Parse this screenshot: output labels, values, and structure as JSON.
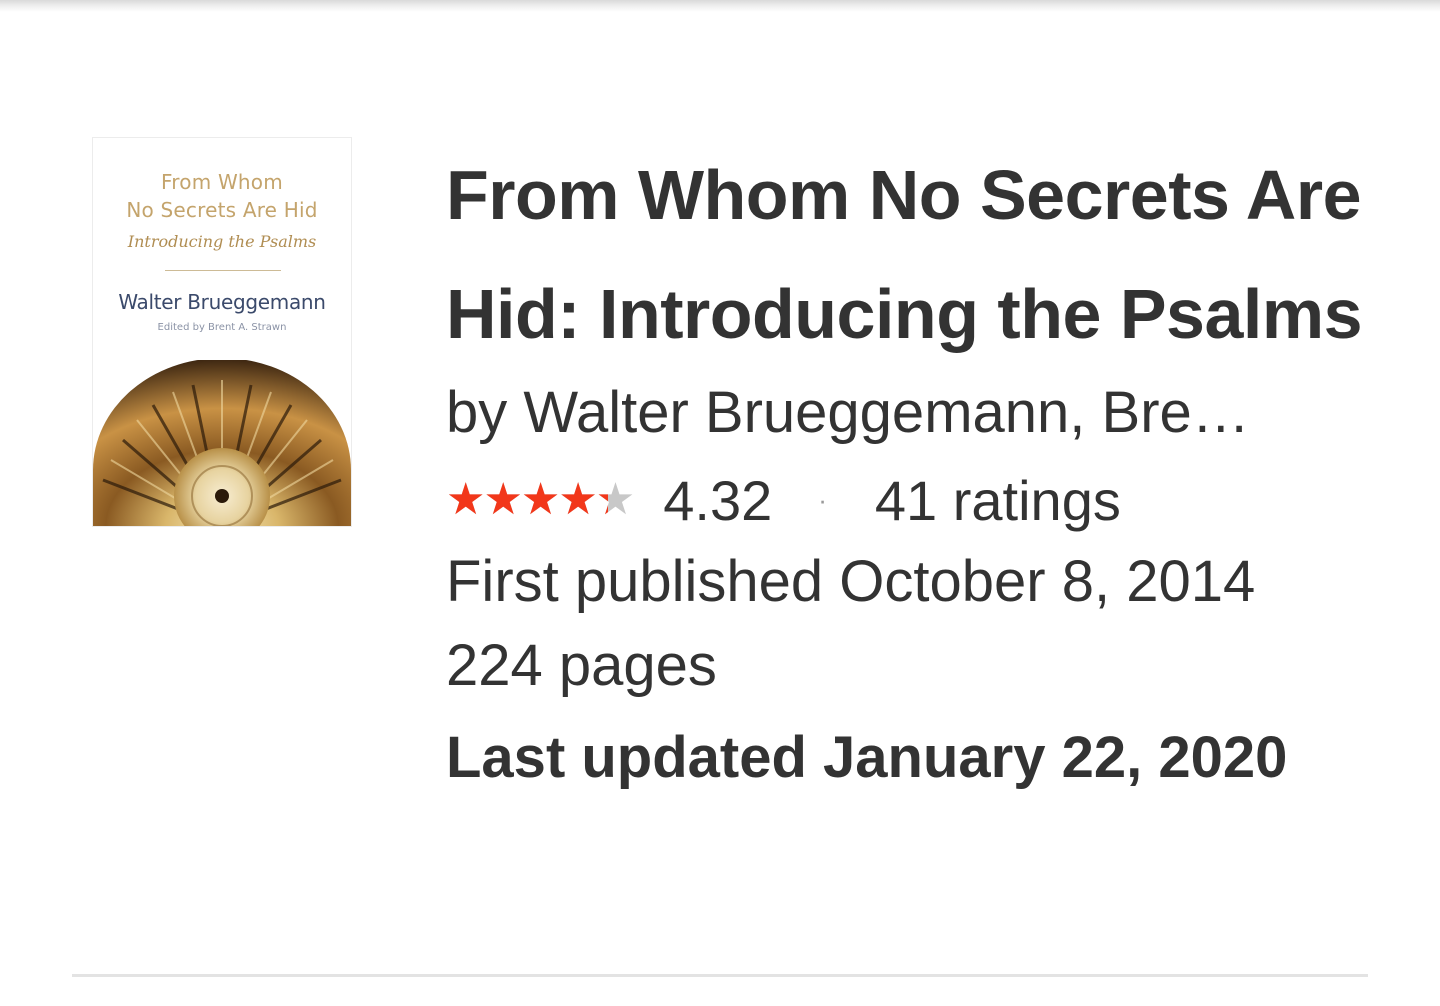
{
  "book": {
    "cover": {
      "title_line1": "From Whom",
      "title_line2": "No Secrets Are Hid",
      "subtitle": "Introducing the Psalms",
      "author": "Walter Brueggemann",
      "editor": "Edited by Brent A. Strawn",
      "accent_color": "#c4a46c"
    },
    "title": "From Whom No Secrets Are Hid: Introducing the Psalms",
    "author_line": "by Walter Brueggemann, Bre…",
    "rating": {
      "stars": "★★★★★",
      "star_fill_fraction": 0.864,
      "star_color": "#f2371a",
      "value": "4.32",
      "separator": "·",
      "count": "41 ratings"
    },
    "first_published": "First published October 8, 2014",
    "pages": "224 pages",
    "last_updated": "Last updated January 22, 2020"
  }
}
